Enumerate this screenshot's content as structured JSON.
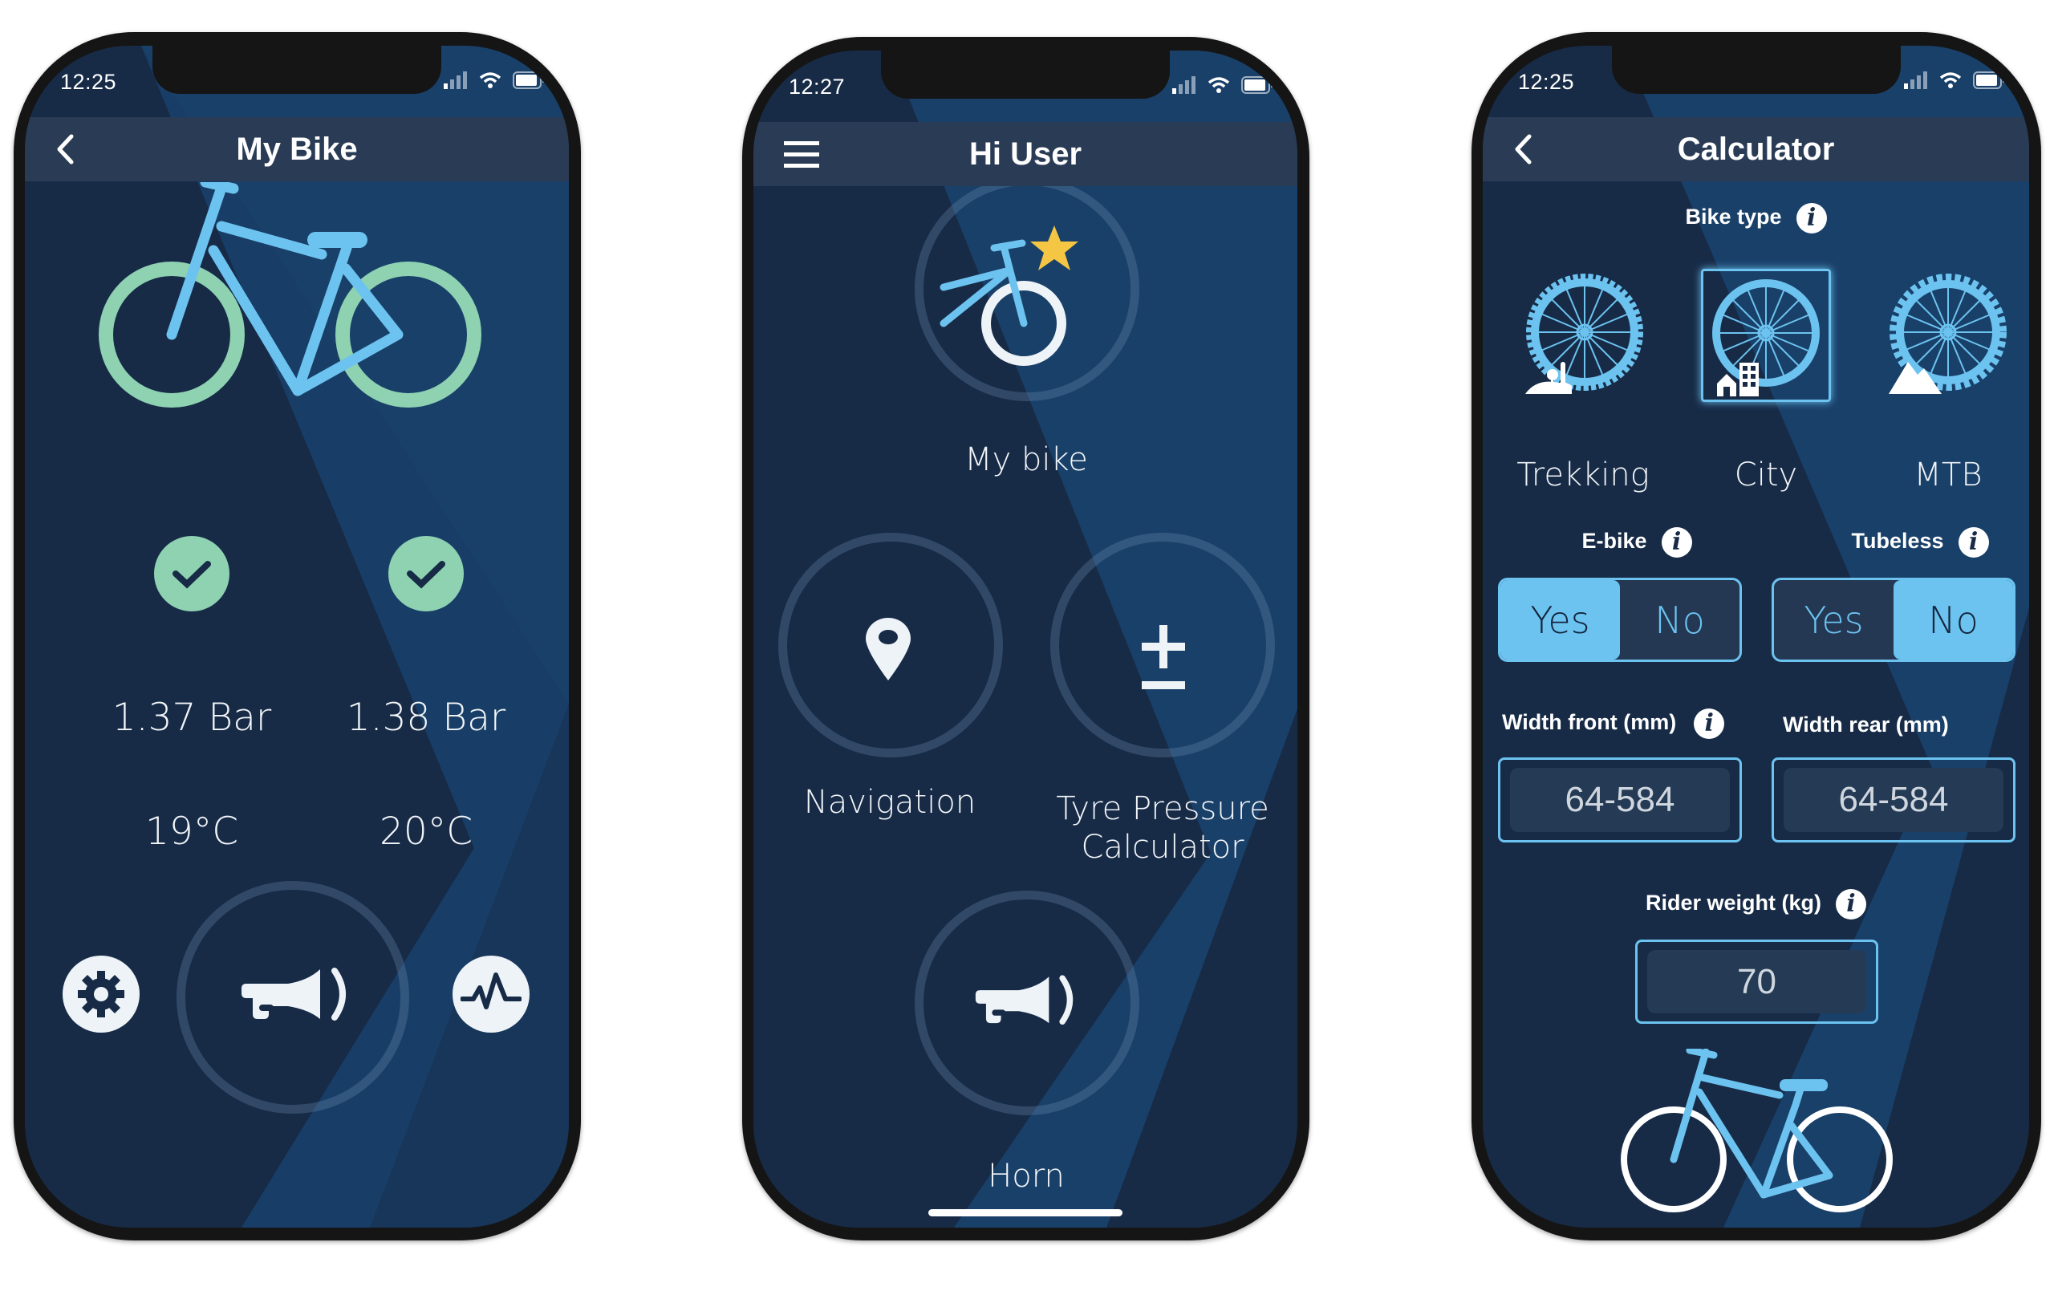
{
  "colors": {
    "screen_dark": "#172b47",
    "screen_light": "#1a4470",
    "header_bg": "#2a3c55",
    "accent_blue": "#6cc3f0",
    "accent_green": "#8ed2b2",
    "star_yellow": "#f5c643",
    "frame": "#151515"
  },
  "phones": [
    {
      "status": {
        "time": "12:25"
      },
      "header": {
        "title": "My Bike",
        "left_icon": "back-chevron-icon"
      },
      "tyres": [
        {
          "position": "front",
          "status_icon": "check-icon",
          "status": "ok",
          "pressure": "1.37 Bar",
          "temperature": "19°C"
        },
        {
          "position": "rear",
          "status_icon": "check-icon",
          "status": "ok",
          "pressure": "1.38 Bar",
          "temperature": "20°C"
        }
      ],
      "actions": {
        "settings_icon": "gear-icon",
        "horn_icon": "horn-icon",
        "activity_icon": "pulse-icon"
      }
    },
    {
      "status": {
        "time": "12:27"
      },
      "header": {
        "title": "Hi User",
        "left_icon": "hamburger-menu-icon"
      },
      "menu": [
        {
          "label": "My bike",
          "icon": "bike-star-icon"
        },
        {
          "label": "Navigation",
          "icon": "map-pin-icon"
        },
        {
          "label_line1": "Tyre Pressure",
          "label_line2": "Calculator",
          "icon": "plus-minus-icon"
        },
        {
          "label": "Horn",
          "icon": "horn-icon"
        }
      ]
    },
    {
      "status": {
        "time": "12:25"
      },
      "header": {
        "title": "Calculator",
        "left_icon": "back-chevron-icon"
      },
      "bike_type": {
        "label": "Bike type",
        "options": [
          {
            "label": "Trekking",
            "icon": "trekking-wheel-icon",
            "selected": false
          },
          {
            "label": "City",
            "icon": "city-wheel-icon",
            "selected": true
          },
          {
            "label": "MTB",
            "icon": "mtb-wheel-icon",
            "selected": false
          }
        ]
      },
      "ebike": {
        "label": "E-bike",
        "yes": "Yes",
        "no": "No",
        "value": "Yes"
      },
      "tubeless": {
        "label": "Tubeless",
        "yes": "Yes",
        "no": "No",
        "value": "No"
      },
      "width_front": {
        "label": "Width front (mm)",
        "value": "64-584"
      },
      "width_rear": {
        "label": "Width rear (mm)",
        "value": "64-584"
      },
      "rider_weight": {
        "label": "Rider weight (kg)",
        "value": "70"
      },
      "info_glyph": "i"
    }
  ]
}
